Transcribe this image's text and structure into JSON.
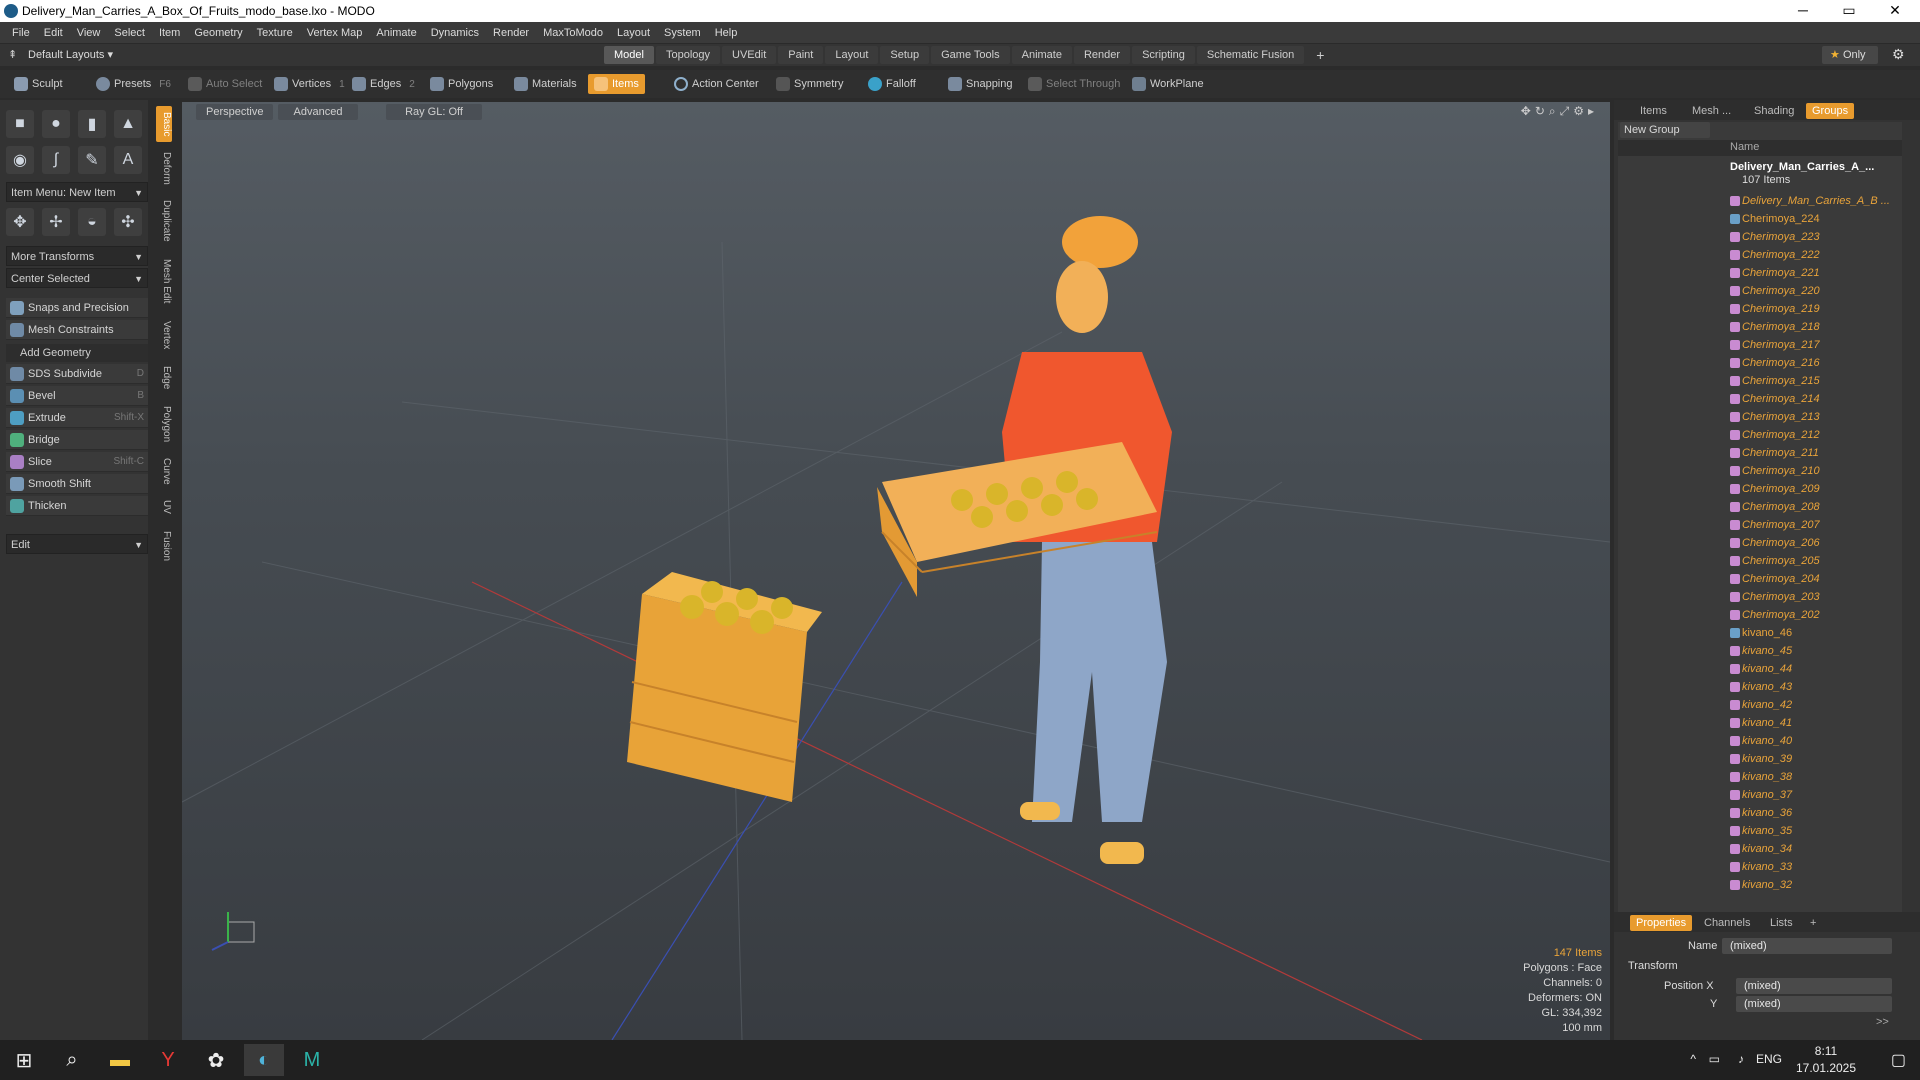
{
  "window": {
    "title": "Delivery_Man_Carries_A_Box_Of_Fruits_modo_base.lxo - MODO",
    "min": "─",
    "max": "▭",
    "close": "✕"
  },
  "menu": [
    "File",
    "Edit",
    "View",
    "Select",
    "Item",
    "Geometry",
    "Texture",
    "Vertex Map",
    "Animate",
    "Dynamics",
    "Render",
    "MaxToModo",
    "Layout",
    "System",
    "Help"
  ],
  "layout": {
    "default_layouts": "Default Layouts ▾",
    "tabs": [
      "Model",
      "Topology",
      "UVEdit",
      "Paint",
      "Layout",
      "Setup",
      "Game Tools",
      "Animate",
      "Render",
      "Scripting",
      "Schematic Fusion"
    ],
    "active_tab": "Model",
    "add": "+",
    "only": "Only"
  },
  "toolbar": {
    "sculpt": "Sculpt",
    "presets": "Presets",
    "presets_key": "F6",
    "auto_select": "Auto Select",
    "vertices": "Vertices",
    "vertices_key": "1",
    "edges": "Edges",
    "edges_key": "2",
    "polygons": "Polygons",
    "materials": "Materials",
    "items": "Items",
    "action_center": "Action Center",
    "symmetry": "Symmetry",
    "falloff": "Falloff",
    "snapping": "Snapping",
    "select_through": "Select Through",
    "workplane": "WorkPlane"
  },
  "left": {
    "item_menu": "Item Menu: New Item",
    "more_transforms": "More Transforms",
    "center_selected": "Center Selected",
    "snaps": "Snaps and Precision",
    "mesh_constraints": "Mesh Constraints",
    "add_geometry": "Add Geometry",
    "tools": [
      {
        "label": "SDS Subdivide",
        "key": "D"
      },
      {
        "label": "Bevel",
        "key": "B"
      },
      {
        "label": "Extrude",
        "key": "Shift-X"
      },
      {
        "label": "Bridge",
        "key": ""
      },
      {
        "label": "Slice",
        "key": "Shift-C"
      },
      {
        "label": "Smooth Shift",
        "key": ""
      },
      {
        "label": "Thicken",
        "key": ""
      }
    ],
    "edit": "Edit",
    "vtabs": [
      "Basic",
      "Deform",
      "Duplicate",
      "Mesh Edit",
      "Vertex",
      "Edge",
      "Polygon",
      "Curve",
      "UV",
      "Fusion"
    ]
  },
  "viewport": {
    "perspective": "Perspective",
    "advanced": "Advanced",
    "raygl": "Ray GL: Off",
    "info": {
      "items": "147 Items",
      "polygons": "Polygons : Face",
      "channels": "Channels: 0",
      "deformers": "Deformers: ON",
      "gl": "GL: 334,392",
      "scale": "100 mm"
    }
  },
  "right": {
    "tabs": [
      "Items",
      "Mesh ...",
      "Shading",
      "Groups"
    ],
    "active_tab": "Groups",
    "new_group": "New Group",
    "col_name": "Name",
    "root": "Delivery_Man_Carries_A_...",
    "root_count": "107 Items",
    "rows": [
      "Delivery_Man_Carries_A_B ...",
      "Cherimoya_224",
      "Cherimoya_223",
      "Cherimoya_222",
      "Cherimoya_221",
      "Cherimoya_220",
      "Cherimoya_219",
      "Cherimoya_218",
      "Cherimoya_217",
      "Cherimoya_216",
      "Cherimoya_215",
      "Cherimoya_214",
      "Cherimoya_213",
      "Cherimoya_212",
      "Cherimoya_211",
      "Cherimoya_210",
      "Cherimoya_209",
      "Cherimoya_208",
      "Cherimoya_207",
      "Cherimoya_206",
      "Cherimoya_205",
      "Cherimoya_204",
      "Cherimoya_203",
      "Cherimoya_202",
      "kivano_46",
      "kivano_45",
      "kivano_44",
      "kivano_43",
      "kivano_42",
      "kivano_41",
      "kivano_40",
      "kivano_39",
      "kivano_38",
      "kivano_37",
      "kivano_36",
      "kivano_35",
      "kivano_34",
      "kivano_33",
      "kivano_32"
    ],
    "props_tabs": [
      "Properties",
      "Channels",
      "Lists"
    ],
    "props_add": "+",
    "name_label": "Name",
    "name_value": "(mixed)",
    "transform": "Transform",
    "pos_x_label": "Position X",
    "pos_x": "(mixed)",
    "pos_y_label": "Y",
    "pos_y": "(mixed)",
    "more": ">>"
  },
  "taskbar": {
    "lang": "ENG",
    "time": "8:11",
    "date": "17.01.2025"
  }
}
